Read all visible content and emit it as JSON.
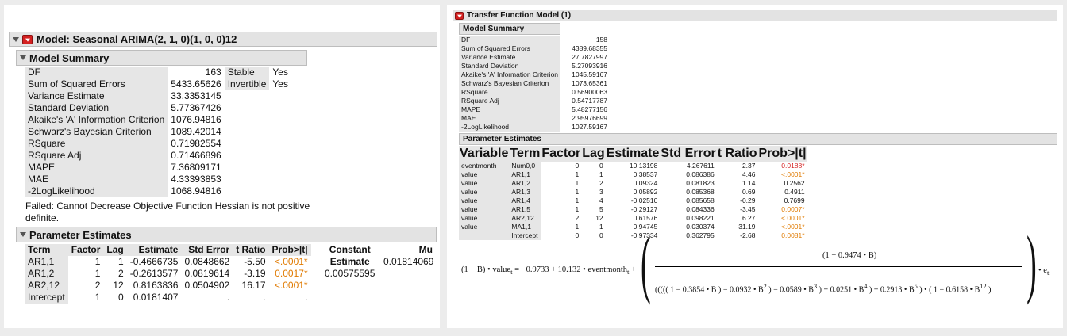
{
  "left": {
    "title": "Model: Seasonal ARIMA(2, 1, 0)(1, 0, 0)12",
    "summary_title": "Model Summary",
    "summary": [
      {
        "label": "DF",
        "value": "163"
      },
      {
        "label": "Sum of Squared Errors",
        "value": "5433.65626"
      },
      {
        "label": "Variance Estimate",
        "value": "33.3353145"
      },
      {
        "label": "Standard Deviation",
        "value": "5.77367426"
      },
      {
        "label": "Akaike's 'A' Information Criterion",
        "value": "1076.94816"
      },
      {
        "label": "Schwarz's Bayesian Criterion",
        "value": "1089.42014"
      },
      {
        "label": "RSquare",
        "value": "0.71982554"
      },
      {
        "label": "RSquare Adj",
        "value": "0.71466896"
      },
      {
        "label": "MAPE",
        "value": "7.36809171"
      },
      {
        "label": "MAE",
        "value": "4.33393853"
      },
      {
        "label": "-2LogLikelihood",
        "value": "1068.94816"
      }
    ],
    "flags": [
      {
        "label": "Stable",
        "value": "Yes"
      },
      {
        "label": "Invertible",
        "value": "Yes"
      }
    ],
    "failed_line1": "Failed: Cannot Decrease Objective Function Hessian is not positive",
    "failed_line2": "definite.",
    "pe_title": "Parameter Estimates",
    "pe_headers": [
      "Term",
      "Factor",
      "Lag",
      "Estimate",
      "Std Error",
      "t Ratio",
      "Prob>|t|"
    ],
    "pe_rows": [
      [
        "AR1,1",
        "1",
        "1",
        "-0.4666735",
        "0.0848662",
        "-5.50",
        "<.0001*"
      ],
      [
        "AR1,2",
        "1",
        "2",
        "-0.2613577",
        "0.0819614",
        "-3.19",
        "0.0017*"
      ],
      [
        "AR2,12",
        "2",
        "12",
        "0.8163836",
        "0.0504902",
        "16.17",
        "<.0001*"
      ],
      [
        "Intercept",
        "1",
        "0",
        "0.0181407",
        ".",
        ".",
        "."
      ]
    ],
    "constant": {
      "header": "Constant",
      "sub": "Estimate",
      "value": "0.00575595"
    },
    "mu": {
      "header": "Mu",
      "value": "0.01814069"
    }
  },
  "right": {
    "title": "Transfer Function Model (1)",
    "summary_title": "Model Summary",
    "summary": [
      {
        "label": "DF",
        "value": "158"
      },
      {
        "label": "Sum of Squared Errors",
        "value": "4389.68355"
      },
      {
        "label": "Variance Estimate",
        "value": "27.7827997"
      },
      {
        "label": "Standard Deviation",
        "value": "5.27093916"
      },
      {
        "label": "Akaike's 'A' Information Criterion",
        "value": "1045.59167"
      },
      {
        "label": "Schwarz's Bayesian Criterion",
        "value": "1073.65361"
      },
      {
        "label": "RSquare",
        "value": "0.56900063"
      },
      {
        "label": "RSquare Adj",
        "value": "0.54717787"
      },
      {
        "label": "MAPE",
        "value": "5.48277156"
      },
      {
        "label": "MAE",
        "value": "2.95976699"
      },
      {
        "label": "-2LogLikelihood",
        "value": "1027.59167"
      }
    ],
    "pe_title": "Parameter Estimates",
    "pe_headers": [
      "Variable",
      "Term",
      "Factor",
      "Lag",
      "Estimate",
      "Std Error",
      "t Ratio",
      "Prob>|t|"
    ],
    "pe_rows": [
      [
        "eventmonth",
        "Num0,0",
        "0",
        "0",
        "10.13198",
        "4.267611",
        "2.37",
        "0.0188*"
      ],
      [
        "value",
        "AR1,1",
        "1",
        "1",
        "0.38537",
        "0.086386",
        "4.46",
        "<.0001*"
      ],
      [
        "value",
        "AR1,2",
        "1",
        "2",
        "0.09324",
        "0.081823",
        "1.14",
        "0.2562"
      ],
      [
        "value",
        "AR1,3",
        "1",
        "3",
        "0.05892",
        "0.085368",
        "0.69",
        "0.4911"
      ],
      [
        "value",
        "AR1,4",
        "1",
        "4",
        "-0.02510",
        "0.085658",
        "-0.29",
        "0.7699"
      ],
      [
        "value",
        "AR1,5",
        "1",
        "5",
        "-0.29127",
        "0.084336",
        "-3.45",
        "0.0007*"
      ],
      [
        "value",
        "AR2,12",
        "2",
        "12",
        "0.61576",
        "0.098221",
        "6.27",
        "<.0001*"
      ],
      [
        "value",
        "MA1,1",
        "1",
        "1",
        "0.94745",
        "0.030374",
        "31.19",
        "<.0001*"
      ],
      [
        "",
        "Intercept",
        "0",
        "0",
        "-0.97334",
        "0.362795",
        "-2.68",
        "0.0081*"
      ]
    ],
    "equation": {
      "lhs_ops": "(1 − B) • value",
      "sub_t": "t",
      "rhs_a": "= −0.9733 + 10.132 • eventmonth",
      "plus": "+",
      "numerator": "(1 − 0.9474 • B)",
      "ar_terms": [
        "1 − 0.3854 • B",
        "− 0.0932 • B",
        "− 0.0589 • B",
        "+ 0.0251 • B",
        "+ 0.2913 • B"
      ],
      "ar_powers": [
        "2",
        "3",
        "4",
        "5"
      ],
      "seasonal": "1 − 0.6158 • B",
      "seasonal_power": "12",
      "times": "•",
      "err": "• e"
    }
  }
}
